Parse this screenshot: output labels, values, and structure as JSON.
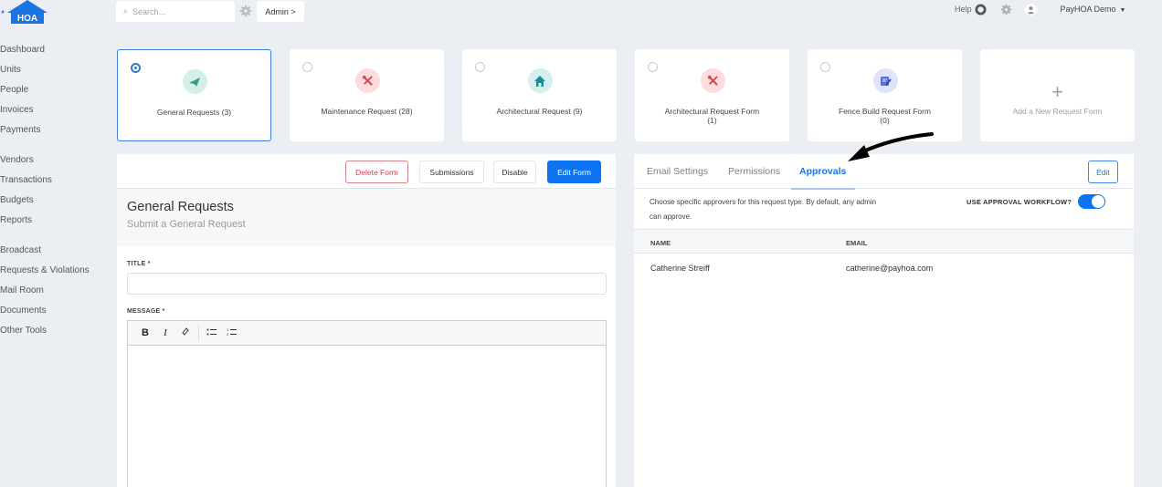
{
  "header": {
    "logo_text": "HOA",
    "search_placeholder": "Search...",
    "admin_label": "Admin >",
    "help_label": "Help",
    "user_menu_label": "PayHOA Demo"
  },
  "sidebar": {
    "groups": [
      [
        "Dashboard",
        "Units",
        "People",
        "Invoices",
        "Payments"
      ],
      [
        "Vendors",
        "Transactions",
        "Budgets",
        "Reports"
      ],
      [
        "Broadcast",
        "Requests & Violations",
        "Mail Room",
        "Documents",
        "Other Tools"
      ]
    ]
  },
  "request_types": [
    {
      "label": "General Requests (3)",
      "icon": "paper-plane-icon",
      "selected": true
    },
    {
      "label": "Maintenance Request (28)",
      "icon": "tools-icon",
      "selected": false
    },
    {
      "label": "Architectural Request (9)",
      "icon": "home-icon",
      "selected": false
    },
    {
      "label": "Architectural Request Form\n(1)",
      "icon": "tools-icon",
      "selected": false
    },
    {
      "label": "Fence Build Request Form\n(0)",
      "icon": "edit-form-icon",
      "selected": false
    }
  ],
  "add_card": {
    "label": "Add a New Request Form"
  },
  "form_toolbar": {
    "delete_label": "Delete Form",
    "submissions_label": "Submissions",
    "disable_label": "Disable",
    "edit_label": "Edit Form"
  },
  "form": {
    "title": "General Requests",
    "subtitle": "Submit a General Request",
    "title_field_label": "TITLE *",
    "title_value": "",
    "message_field_label": "MESSAGE *",
    "message_value": "",
    "editor_tools": [
      "B",
      "I",
      "link",
      "bulleted-list",
      "numbered-list"
    ]
  },
  "settings": {
    "tabs": [
      {
        "label": "Email Settings",
        "active": false
      },
      {
        "label": "Permissions",
        "active": false
      },
      {
        "label": "Approvals",
        "active": true
      }
    ],
    "edit_label": "Edit",
    "description": "Choose specific approvers for this request type. By default, any admin can approve.",
    "workflow_label": "USE APPROVAL WORKFLOW?",
    "workflow_enabled": true,
    "table": {
      "columns": [
        "NAME",
        "EMAIL"
      ],
      "rows": [
        {
          "name": "Catherine Streiff",
          "email": "catherine@payhoa.com"
        }
      ]
    }
  },
  "colors": {
    "accent": "#0c74f0",
    "danger": "#d6394a",
    "background": "#ebeef2"
  }
}
